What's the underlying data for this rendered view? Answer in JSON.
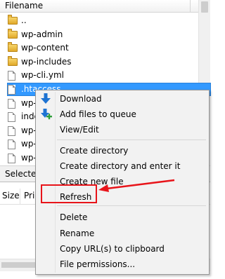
{
  "file_list": {
    "column_header": "Filename",
    "rows": [
      {
        "name": "..",
        "type": "folder"
      },
      {
        "name": "wp-admin",
        "type": "folder"
      },
      {
        "name": "wp-content",
        "type": "folder"
      },
      {
        "name": "wp-includes",
        "type": "folder"
      },
      {
        "name": "wp-cli.yml",
        "type": "file"
      },
      {
        "name": ".htaccess",
        "type": "file",
        "selected": true
      },
      {
        "name": "wp-",
        "type": "file"
      },
      {
        "name": "inde",
        "type": "file"
      },
      {
        "name": "wp-",
        "type": "file"
      },
      {
        "name": "wp-",
        "type": "file"
      },
      {
        "name": "wp-",
        "type": "file"
      }
    ]
  },
  "status_text": "Selected",
  "queue": {
    "columns": [
      "Size",
      "Prio"
    ]
  },
  "context_menu": {
    "items": [
      {
        "label": "Download",
        "icon": "download-icon"
      },
      {
        "label": "Add files to queue",
        "icon": "add-to-queue-icon"
      },
      {
        "label": "View/Edit"
      },
      {
        "label": "Create directory"
      },
      {
        "label": "Create directory and enter it"
      },
      {
        "label": "Create new file"
      },
      {
        "label": "Refresh"
      },
      {
        "label": "Delete",
        "highlighted": true
      },
      {
        "label": "Rename"
      },
      {
        "label": "Copy URL(s) to clipboard"
      },
      {
        "label": "File permissions..."
      }
    ]
  },
  "colors": {
    "selection": "#3399ff",
    "annotation": "#e8141a",
    "menu_background": "#f2f2f2"
  }
}
